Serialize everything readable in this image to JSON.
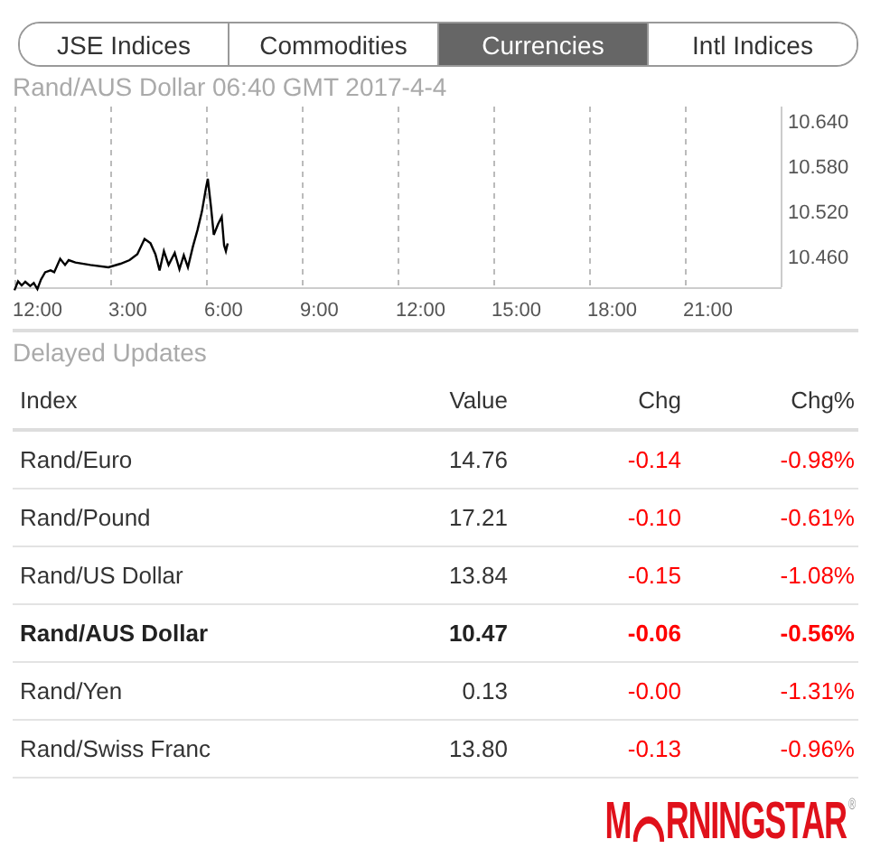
{
  "tabs": [
    {
      "label": "JSE Indices",
      "selected": false
    },
    {
      "label": "Commodities",
      "selected": false
    },
    {
      "label": "Currencies",
      "selected": true
    },
    {
      "label": "Intl Indices",
      "selected": false
    }
  ],
  "chart": {
    "title": "Rand/AUS Dollar 06:40 GMT 2017-4-4",
    "x_axis_labels": [
      "12:00",
      "3:00",
      "6:00",
      "9:00",
      "12:00",
      "15:00",
      "18:00",
      "21:00"
    ],
    "y_axis_labels": [
      "10.640",
      "10.580",
      "10.520",
      "10.460"
    ]
  },
  "section_title": "Delayed Updates",
  "table": {
    "columns": [
      "Index",
      "Value",
      "Chg",
      "Chg%"
    ],
    "rows": [
      {
        "name": "Rand/Euro",
        "value": "14.76",
        "chg": "-0.14",
        "chg_pct": "-0.98%",
        "selected": false
      },
      {
        "name": "Rand/Pound",
        "value": "17.21",
        "chg": "-0.10",
        "chg_pct": "-0.61%",
        "selected": false
      },
      {
        "name": "Rand/US Dollar",
        "value": "13.84",
        "chg": "-0.15",
        "chg_pct": "-1.08%",
        "selected": false
      },
      {
        "name": "Rand/AUS Dollar",
        "value": "10.47",
        "chg": "-0.06",
        "chg_pct": "-0.56%",
        "selected": true
      },
      {
        "name": "Rand/Yen",
        "value": "0.13",
        "chg": "-0.00",
        "chg_pct": "-1.31%",
        "selected": false
      },
      {
        "name": "Rand/Swiss Franc",
        "value": "13.80",
        "chg": "-0.13",
        "chg_pct": "-0.96%",
        "selected": false
      }
    ]
  },
  "logo": {
    "lead": "M",
    "rest": "RNINGSTAR",
    "registered": "®"
  }
}
